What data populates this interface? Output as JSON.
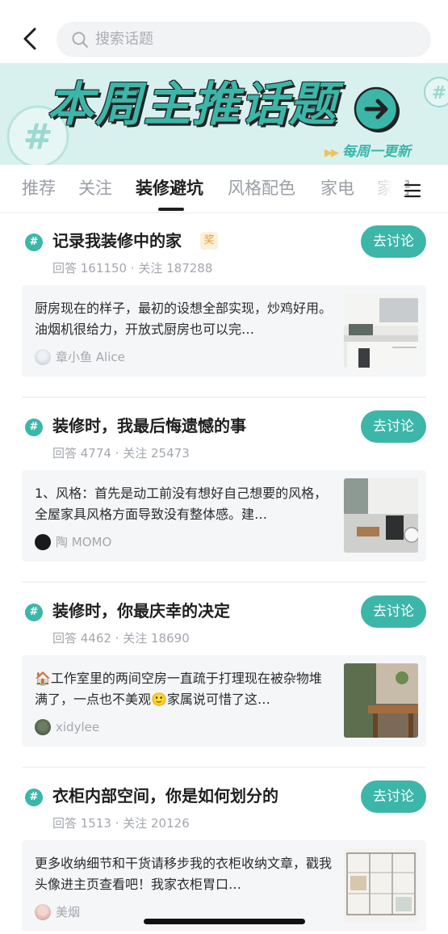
{
  "search": {
    "placeholder": "搜索话题"
  },
  "banner": {
    "title": "本周主推话题",
    "subtitle": "每周一更新"
  },
  "tabs": [
    {
      "label": "推荐"
    },
    {
      "label": "关注"
    },
    {
      "label": "装修避坑",
      "active": true
    },
    {
      "label": "风格配色"
    },
    {
      "label": "家电"
    },
    {
      "label": "家居"
    }
  ],
  "colors": {
    "accent": "#3cb6a9",
    "card_bg": "#f5f6f8",
    "muted_text": "#a3a7ad"
  },
  "topics": [
    {
      "title": "记录我装修中的家",
      "badge": "奖",
      "stats": "回答 161150 · 关注 187288",
      "button": "去讨论",
      "post": {
        "text": "厨房现在的样子，最初的设想全部实现，炒鸡好用。油烟机很给力，开放式厨房也可以完…",
        "author": "章小鱼 Alice"
      }
    },
    {
      "title": "装修时，我最后悔遗憾的事",
      "stats": "回答 4774 · 关注 25473",
      "button": "去讨论",
      "post": {
        "text": "1、风格：首先是动工前没有想好自己想要的风格，全屋家具风格方面导致没有整体感。建…",
        "author": "陶 MOMO"
      }
    },
    {
      "title": "装修时，你最庆幸的决定",
      "stats": "回答 4462 · 关注 18690",
      "button": "去讨论",
      "post": {
        "text": "🏠工作室里的两间空房一直疏于打理现在被杂物堆满了，一点也不美观🙂家属说可惜了这…",
        "author": "xidylee"
      }
    },
    {
      "title": "衣柜内部空间，你是如何划分的",
      "stats": "回答 1513 · 关注 20126",
      "button": "去讨论",
      "post": {
        "text": "更多收纳细节和干货请移步我的衣柜收纳文章，戳我头像进主页查看吧！我家衣柜胃口…",
        "author": "美烟"
      }
    }
  ]
}
